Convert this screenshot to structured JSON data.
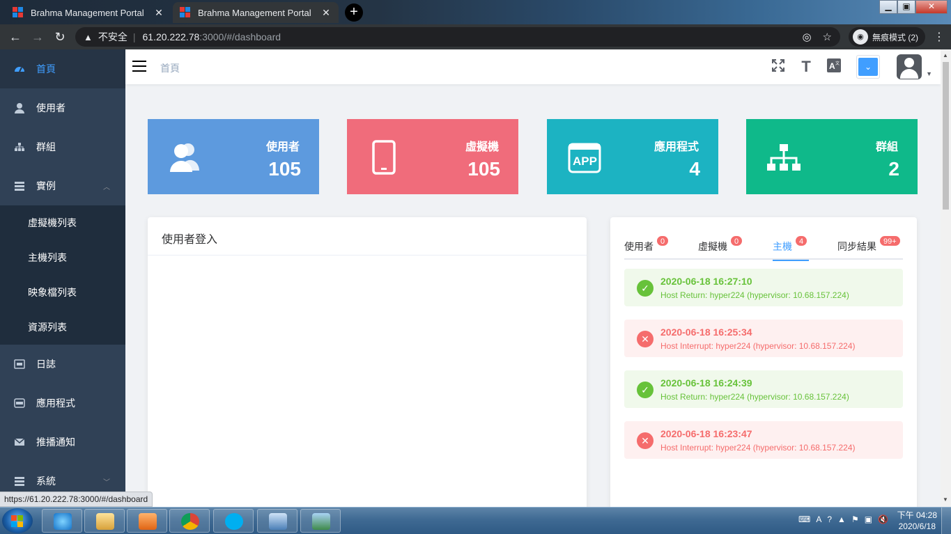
{
  "browser": {
    "tabs": [
      {
        "title": "Brahma Management Portal",
        "close": "✕"
      },
      {
        "title": "Brahma Management Portal",
        "close": "✕"
      }
    ],
    "new_tab": "+",
    "security_label": "不安全",
    "url_host": "61.20.222.78",
    "url_path": ":3000/#/dashboard",
    "incognito_label": "無痕模式 (2)",
    "status_url": "https://61.20.222.78:3000/#/dashboard"
  },
  "sidebar": {
    "items": [
      {
        "label": "首頁",
        "icon": "dashboard-icon",
        "active": true
      },
      {
        "label": "使用者",
        "icon": "user-icon"
      },
      {
        "label": "群組",
        "icon": "tree-icon"
      },
      {
        "label": "實例",
        "icon": "server-icon",
        "expanded": true
      }
    ],
    "submenu": [
      {
        "label": "虛擬機列表"
      },
      {
        "label": "主機列表"
      },
      {
        "label": "映象檔列表"
      },
      {
        "label": "資源列表"
      }
    ],
    "items_after": [
      {
        "label": "日誌",
        "icon": "log-icon"
      },
      {
        "label": "應用程式",
        "icon": "app-icon"
      },
      {
        "label": "推播通知",
        "icon": "mail-icon"
      },
      {
        "label": "系統",
        "icon": "system-icon"
      }
    ]
  },
  "navbar": {
    "breadcrumb": "首頁",
    "lang_value": "⌄"
  },
  "stats": [
    {
      "label": "使用者",
      "value": "105",
      "color": "#5d9ade",
      "icon": "users-icon"
    },
    {
      "label": "虛擬機",
      "value": "105",
      "color": "#f06c7b",
      "icon": "tablet-icon"
    },
    {
      "label": "應用程式",
      "value": "4",
      "color": "#1cb3c2",
      "icon": "app-icon"
    },
    {
      "label": "群組",
      "value": "2",
      "color": "#0fb98a",
      "icon": "sitemap-icon"
    }
  ],
  "login_card": {
    "title": "使用者登入"
  },
  "events_card": {
    "tabs": [
      {
        "label": "使用者",
        "badge": "0"
      },
      {
        "label": "虛擬機",
        "badge": "0"
      },
      {
        "label": "主機",
        "badge": "4",
        "active": true
      },
      {
        "label": "同步結果",
        "badge": "99+"
      }
    ],
    "alerts": [
      {
        "type": "success",
        "time": "2020-06-18 16:27:10",
        "message": "Host Return: hyper224 (hypervisor: 10.68.157.224)"
      },
      {
        "type": "error",
        "time": "2020-06-18 16:25:34",
        "message": "Host Interrupt: hyper224 (hypervisor: 10.68.157.224)"
      },
      {
        "type": "success",
        "time": "2020-06-18 16:24:39",
        "message": "Host Return: hyper224 (hypervisor: 10.68.157.224)"
      },
      {
        "type": "error",
        "time": "2020-06-18 16:23:47",
        "message": "Host Interrupt: hyper224 (hypervisor: 10.68.157.224)"
      }
    ]
  },
  "taskbar": {
    "apps": [
      "ie-icon",
      "explorer-icon",
      "media-player-icon",
      "chrome-icon",
      "skype-icon",
      "remote-desktop-icon",
      "image-viewer-icon"
    ],
    "clock_time": "下午 04:28",
    "clock_date": "2020/6/18"
  }
}
